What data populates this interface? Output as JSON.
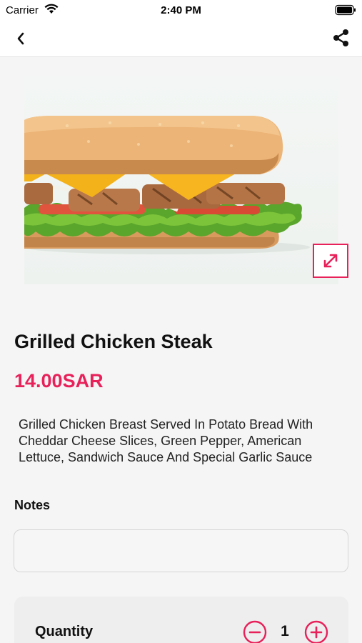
{
  "status_bar": {
    "carrier": "Carrier",
    "time": "2:40 PM"
  },
  "nav": {
    "back_icon": "chevron-left-icon",
    "share_icon": "share-icon"
  },
  "product": {
    "image_alt": "sandwich photo",
    "title": "Grilled Chicken Steak",
    "price": "14.00SAR",
    "description": "Grilled Chicken Breast Served In Potato Bread With Cheddar Cheese Slices, Green Pepper, American Lettuce, Sandwich Sauce And Special Garlic Sauce"
  },
  "notes": {
    "label": "Notes",
    "value": "",
    "placeholder": ""
  },
  "quantity": {
    "label": "Quantity",
    "value": "1"
  },
  "colors": {
    "accent": "#e8215a",
    "background": "#f5f5f5"
  }
}
